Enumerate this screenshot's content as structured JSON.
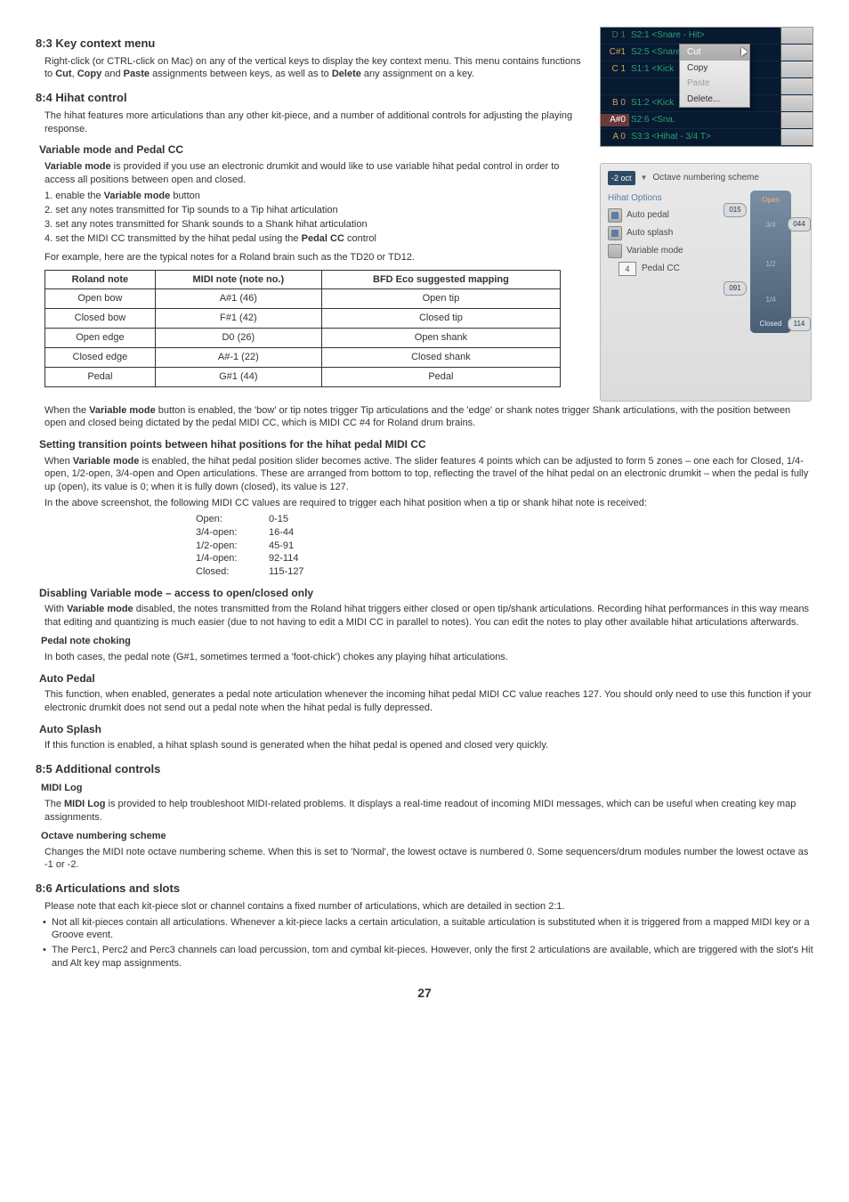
{
  "s83": {
    "title": "8:3 Key context menu",
    "p": "Right-click (or CTRL-click on Mac) on any of the vertical keys to display the key context menu. This menu contains functions to <b>Cut</b>, <b>Copy</b> and <b>Paste</b> assignments between keys, as well as to <b>Delete</b> any assignment on a key."
  },
  "s84": {
    "title": "8:4 Hihat control",
    "p": "The hihat features more articulations than any other kit-piece, and a number of additional controls for adjusting the playing response.",
    "vmode_title": "Variable mode and Pedal CC",
    "vmode_p": "<b>Variable mode</b> is provided if you use an electronic drumkit and would like to use variable hihat pedal control in order to access all positions between open and closed.",
    "steps": [
      "1. enable the <b>Variable mode</b> button",
      "2. set any notes transmitted for Tip sounds to a Tip hihat articulation",
      "3. set any notes transmitted for Shank sounds to a Shank hihat articulation",
      "4. set the MIDI CC transmitted by the hihat pedal using the <b>Pedal CC</b> control"
    ],
    "example_intro": "For example, here are the typical notes for a Roland brain such as the TD20 or TD12."
  },
  "roland": {
    "headers": [
      "Roland note",
      "MIDI note (note no.)",
      "BFD Eco suggested mapping"
    ],
    "rows": [
      [
        "Open bow",
        "A#1 (46)",
        "Open tip"
      ],
      [
        "Closed bow",
        "F#1 (42)",
        "Closed tip"
      ],
      [
        "Open edge",
        "D0 (26)",
        "Open shank"
      ],
      [
        "Closed edge",
        "A#-1 (22)",
        "Closed shank"
      ],
      [
        "Pedal",
        "G#1 (44)",
        "Pedal"
      ]
    ]
  },
  "vmode_after": "When the <b>Variable mode</b> button is enabled, the 'bow' or tip notes trigger Tip articulations and the 'edge' or shank notes trigger Shank articulations, with the position between open and closed being dictated by the pedal MIDI CC, which is MIDI CC #4 for Roland drum brains.",
  "trans": {
    "title": "Setting transition points between hihat positions for the hihat pedal MIDI CC",
    "p1": "When <b>Variable mode</b> is enabled, the hihat pedal position slider becomes active. The slider features 4 points which can be adjusted to form 5 zones – one each for Closed, 1/4-open, 1/2-open, 3/4-open and Open articulations. These are arranged from bottom to top, reflecting the travel of the hihat pedal on an electronic drumkit – when the pedal is fully up (open), its value is 0; when it is fully down (closed), its value is 127.",
    "p2": "In the above screenshot, the following MIDI CC values are required to trigger each hihat position when a tip or shank hihat note is received:",
    "cc": [
      [
        "Open:",
        "0-15"
      ],
      [
        "3/4-open:",
        "16-44"
      ],
      [
        "1/2-open:",
        "45-91"
      ],
      [
        "1/4-open:",
        "92-114"
      ],
      [
        "Closed:",
        "115-127"
      ]
    ]
  },
  "disable": {
    "title": "Disabling Variable mode – access to open/closed only",
    "p": "With <b>Variable mode</b> disabled, the notes transmitted from the Roland hihat triggers either closed or open tip/shank articulations. Recording hihat performances in this way means that editing and quantizing is much easier (due to not having to edit a MIDI CC in parallel to notes). You can edit the notes to play other available hihat articulations afterwards."
  },
  "choke": {
    "title": "Pedal note choking",
    "p": "In both cases, the pedal note (G#1, sometimes termed a 'foot-chick') chokes any playing hihat articulations."
  },
  "autopedal": {
    "title": "Auto Pedal",
    "p": "This function, when enabled, generates a pedal note articulation whenever the incoming hihat pedal MIDI CC value reaches 127. You should only need to use this function if your electronic drumkit does not send out a pedal note when the hihat pedal is fully depressed."
  },
  "autosplash": {
    "title": "Auto Splash",
    "p": "If this function is enabled, a hihat splash sound is generated when the hihat pedal is opened and closed very quickly."
  },
  "s85": {
    "title": "8:5 Additional controls",
    "midilog_title": "MIDI Log",
    "midilog_p": "The <b>MIDI Log</b> is provided to help troubleshoot MIDI-related problems. It displays a real-time readout of incoming MIDI messages, which can be useful when creating key map assignments.",
    "oct_title": "Octave numbering scheme",
    "oct_p": "Changes the MIDI note octave numbering scheme. When this is set to 'Normal', the lowest octave is numbered 0. Some sequencers/drum modules number the lowest octave as -1 or -2."
  },
  "s86": {
    "title": "8:6 Articulations and slots",
    "p": "Please note that each kit-piece slot or channel contains a fixed number of articulations, which are detailed in section 2:1.",
    "bullets": [
      "Not all kit-pieces contain all articulations. Whenever a kit-piece lacks a certain articulation, a suitable articulation is substituted when it is triggered from a mapped MIDI key or a Groove event.",
      "The Perc1, Perc2 and Perc3 channels can load percussion, tom and cymbal kit-pieces. However, only the first 2 articulations are available, which are triggered with the slot's Hit and Alt key map assignments."
    ]
  },
  "pagenum": "27",
  "sc1": {
    "rows": [
      {
        "note": "D 1",
        "label": "S2:1 <Snare - Hit>",
        "notemute": true
      },
      {
        "note": "C#1",
        "label": "S2:5 <Snare - SS>",
        "notemute": false
      },
      {
        "note": "C 1",
        "label": "S1:1 <Kick",
        "notemute": false
      },
      {
        "note": "",
        "label": "",
        "notemute": true
      },
      {
        "note": "B 0",
        "label": "S1:2 <Kick",
        "notemute": false
      },
      {
        "note": "A#0",
        "label": "S2:6 <Sna.",
        "notemute": false,
        "red": true
      },
      {
        "note": "A 0",
        "label": "S3:3 <Hihat - 3/4 T>",
        "notemute": false
      }
    ],
    "menu": [
      "Cut",
      "Copy",
      "Paste",
      "Delete..."
    ]
  },
  "sc2": {
    "oct": "-2 oct",
    "top_label": "Octave numbering scheme",
    "heading": "Hihat Options",
    "opts": {
      "autopedal": "Auto pedal",
      "autosplash": "Auto splash",
      "variable": "Variable mode",
      "pedalcc": "Pedal CC"
    },
    "pedalcc_val": "4",
    "zones": {
      "open": "Open",
      "z34": "3/4",
      "z12": "1/2",
      "z14": "1/4",
      "closed": "Closed"
    },
    "bubbles": {
      "b015": "015",
      "b044": "044",
      "b091": "091",
      "b114": "114"
    }
  }
}
